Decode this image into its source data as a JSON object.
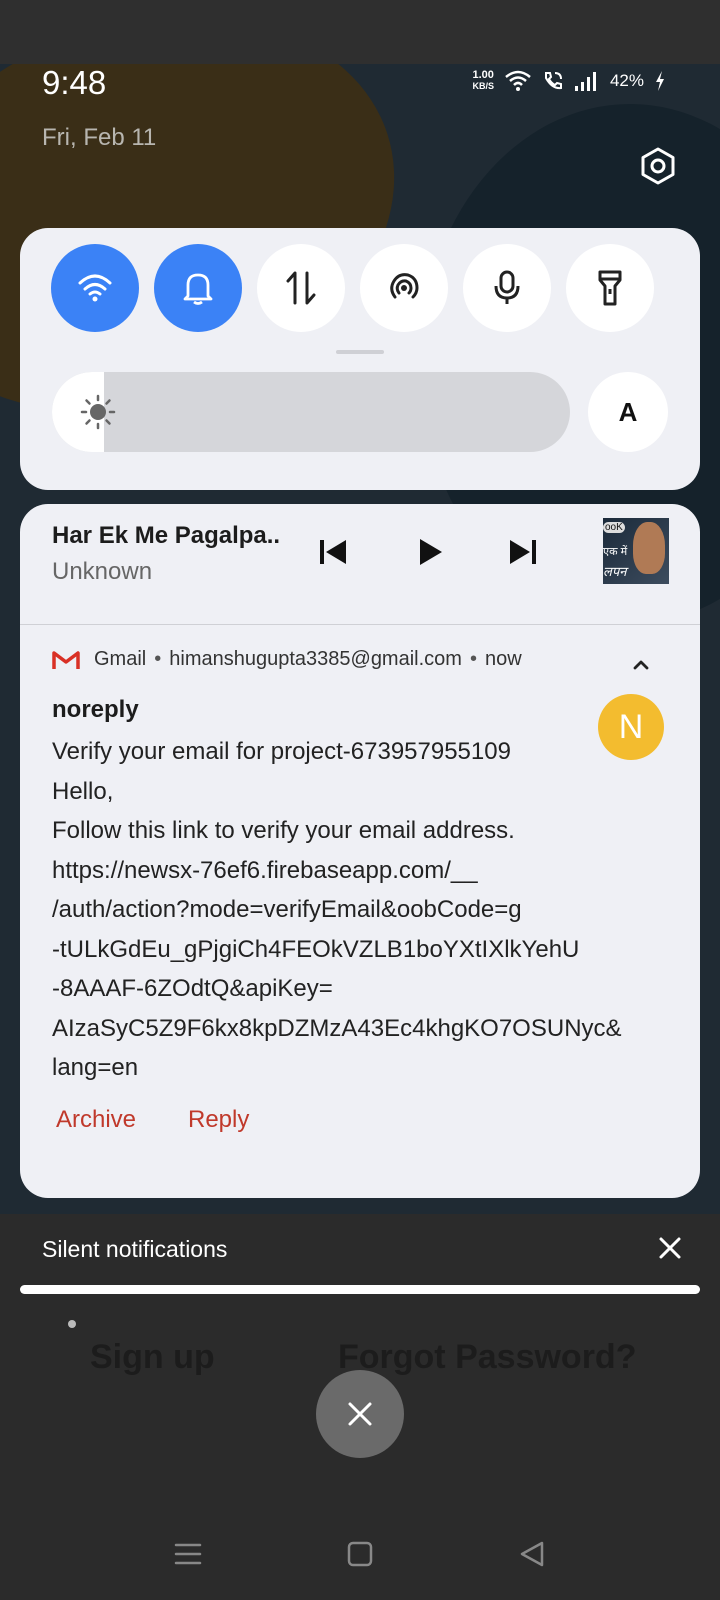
{
  "status_bar": {
    "time": "9:48",
    "date": "Fri, Feb 11",
    "net_speed_value": "1.00",
    "net_speed_unit": "KB/S",
    "battery": "42%"
  },
  "quick_settings": {
    "tiles": [
      {
        "name": "wifi",
        "on": true
      },
      {
        "name": "sound-bell",
        "on": true
      },
      {
        "name": "mobile-data",
        "on": false
      },
      {
        "name": "hotspot",
        "on": false
      },
      {
        "name": "microphone",
        "on": false
      },
      {
        "name": "flashlight",
        "on": false
      }
    ],
    "brightness_level": 0.1,
    "auto_label": "A"
  },
  "media": {
    "title": "Har Ek Me Pagalpa..",
    "artist": "Unknown",
    "album_art_text": [
      "ooK",
      "एक में",
      "लपन"
    ]
  },
  "gmail": {
    "app": "Gmail",
    "account": "himanshugupta3385@gmail.com",
    "time": "now",
    "sender": "noreply",
    "avatar_letter": "N",
    "lines": [
      "Verify your email for project-673957955109",
      "Hello,",
      "Follow this link to verify your email address.",
      "https://newsx-76ef6.firebaseapp.com/__",
      "/auth/action?mode=verifyEmail&oobCode=g",
      "-tULkGdEu_gPjgiCh4FEOkVZLB1boYXtIXlkYehU",
      "-8AAAF-6ZOdtQ&apiKey=",
      "AIzaSyC5Z9F6kx8kpDZMzA43Ec4khgKO7OSUNyc&",
      "lang=en"
    ],
    "actions": {
      "archive": "Archive",
      "reply": "Reply"
    }
  },
  "silent": {
    "label": "Silent notifications"
  },
  "background_app": {
    "signup": "Sign up",
    "forgot": "Forgot Password?"
  },
  "colors": {
    "accent": "#3b82f6",
    "gmail_red": "#c0392b",
    "avatar": "#f3bc2f"
  }
}
